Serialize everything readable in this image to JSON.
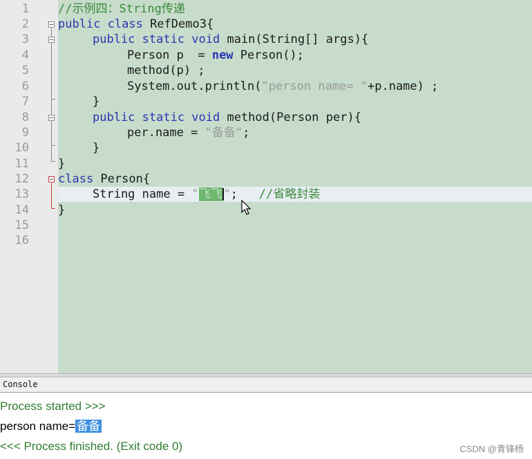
{
  "editor": {
    "lines": [
      {
        "n": "1"
      },
      {
        "n": "2"
      },
      {
        "n": "3"
      },
      {
        "n": "4"
      },
      {
        "n": "5"
      },
      {
        "n": "6"
      },
      {
        "n": "7"
      },
      {
        "n": "8"
      },
      {
        "n": "9"
      },
      {
        "n": "10"
      },
      {
        "n": "11"
      },
      {
        "n": "12"
      },
      {
        "n": "13"
      },
      {
        "n": "14"
      },
      {
        "n": "15"
      },
      {
        "n": "16"
      }
    ],
    "code": {
      "l1_comment": "//示例四：String传递",
      "l2_kw": "public class",
      "l2_rest": " RefDemo3{",
      "l3_kw": "public static void",
      "l3_rest": " main(String[] args){",
      "l4_a": "Person p  = ",
      "l4_new": "new",
      "l4_b": " Person();",
      "l5": "method(p) ;",
      "l6_a": "System.out.println(",
      "l6_str": "\"person name= \"",
      "l6_b": "+p.name) ;",
      "l7": "}",
      "l8_kw": "public static void",
      "l8_rest": " method(Person per){",
      "l9_a": "per.name = ",
      "l9_str": "\"备备\"",
      "l9_b": ";",
      "l10": "}",
      "l11": "}",
      "l12_kw": "class",
      "l12_rest": " Person{",
      "l13_a": "String name = ",
      "l13_q1": "\"",
      "l13_sel": "飞飞",
      "l13_q2": "\"",
      "l13_b": ";   ",
      "l13_comment": "//省略封装",
      "l14": "}"
    }
  },
  "console": {
    "tab_label": "Console",
    "line1": "Process started >>>",
    "line2_prefix": "person name=",
    "line2_value": "备备",
    "line3": "<<< Process finished. (Exit code 0)"
  },
  "watermark": "CSDN @青锋杨",
  "colors": {
    "editor_bg": "#c7dccb",
    "keyword": "#2a35b0",
    "comment": "#3a8a3a",
    "console_green": "#2f7d2f",
    "selection": "#3d8fe0"
  }
}
